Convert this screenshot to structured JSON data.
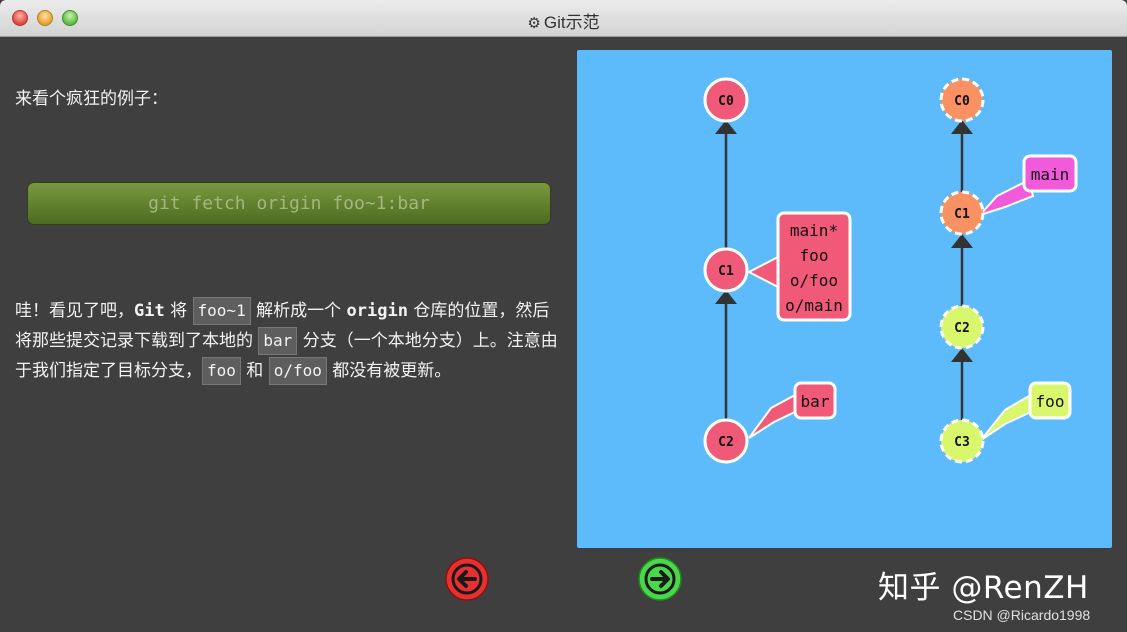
{
  "window": {
    "title": "Git示范",
    "title_icon": "gear-icon"
  },
  "lead_text": "来看个疯狂的例子：",
  "command": "git fetch origin foo~1:bar",
  "paragraph": {
    "p1": "哇！看见了吧，",
    "git_word": "Git",
    "p2": " 将 ",
    "code1": "foo~1",
    "p3": " 解析成一个 ",
    "origin_word": "origin",
    "p4": " 仓库的位置，然后将那些提交记录下载到了本地的 ",
    "code2": "bar",
    "p5": " 分支（一个本地分支）上。注意由于我们指定了目标分支，",
    "code3": "foo",
    "p6": " 和 ",
    "code4": "o/foo",
    "p7": " 都没有被更新。"
  },
  "local": {
    "commits": [
      "C0",
      "C1",
      "C2"
    ],
    "branch_labels": [
      {
        "lines": [
          "main*",
          "foo",
          "o/foo",
          "o/main"
        ]
      },
      {
        "lines": [
          "bar"
        ]
      }
    ]
  },
  "remote": {
    "commits": [
      "C0",
      "C1",
      "C2",
      "C3"
    ],
    "branch_labels": [
      {
        "lines": [
          "main"
        ]
      },
      {
        "lines": [
          "foo"
        ]
      }
    ]
  },
  "colors": {
    "panel_bg": "#5ebbfb",
    "local_commit": "#f05a78",
    "remote_orange": "#f99162",
    "remote_green": "#d8f76d",
    "main_label": "#f05adb",
    "prev_button": "#e83030",
    "next_button": "#4ad74a"
  },
  "nav": {
    "prev_icon": "arrow-left-icon",
    "next_icon": "arrow-right-icon"
  },
  "watermark": "知乎 @RenZH",
  "credit": "CSDN @Ricardo1998"
}
